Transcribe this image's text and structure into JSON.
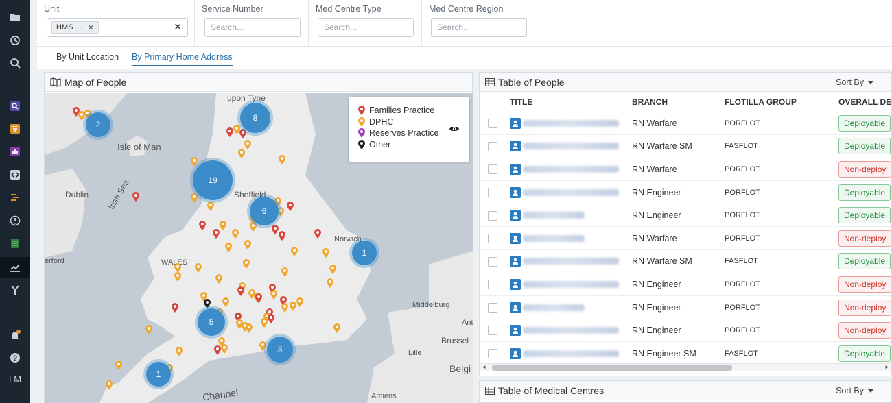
{
  "sidebar": {
    "icons": [
      "folder-icon",
      "history-icon",
      "search-icon",
      "search-square-icon",
      "funnel-icon",
      "bar-chart-icon",
      "code-icon",
      "flow-icon",
      "alert-circle-icon",
      "checklist-icon",
      "line-chart-icon",
      "merge-icon",
      "bell-icon",
      "help-icon"
    ],
    "user_initials": "LM"
  },
  "filters": {
    "unit": {
      "label": "Unit",
      "tag": "HMS    ....",
      "clear": "✕"
    },
    "service_number": {
      "label": "Service Number",
      "placeholder": "Search..."
    },
    "med_centre_type": {
      "label": "Med Centre Type",
      "placeholder": "Search..."
    },
    "med_centre_region": {
      "label": "Med Centre Region",
      "placeholder": "Search..."
    }
  },
  "tabs": [
    {
      "label": "By Unit Location"
    },
    {
      "label": "By Primary Home Address",
      "active": true
    }
  ],
  "map": {
    "title": "Map of People",
    "places": [
      "upon Tyne",
      "Isle of Man",
      "Dublin",
      "Irish Sea",
      "Sheffield",
      "Norwich",
      "erford",
      "WALES",
      "Middelburg",
      "Brussel",
      "Lille",
      "Belgi",
      "Channel",
      "Amiens",
      "Ant"
    ],
    "clusters": [
      "2",
      "8",
      "19",
      "6",
      "1",
      "5",
      "3",
      "1"
    ],
    "legend": [
      {
        "label": "Families Practice",
        "color": "#d8453b"
      },
      {
        "label": "DPHC",
        "color": "#f0a830"
      },
      {
        "label": "Reserves Practice",
        "color": "#a23bb8"
      },
      {
        "label": "Other",
        "color": "#1a1a1a"
      }
    ],
    "pin_colors": {
      "families": "#d8453b",
      "dphc": "#f0a830",
      "other": "#1a1a1a"
    }
  },
  "people_table": {
    "title": "Table of People",
    "sort_label": "Sort By",
    "columns": [
      "TITLE",
      "BRANCH",
      "FLOTILLA GROUP",
      "OVERALL DE"
    ],
    "rows": [
      {
        "branch": "RN Warfare",
        "flotilla": "PORFLOT",
        "status": "Deployable",
        "kind": "dep"
      },
      {
        "branch": "RN Warfare SM",
        "flotilla": "FASFLOT",
        "status": "Deployable",
        "kind": "dep"
      },
      {
        "branch": "RN Warfare",
        "flotilla": "PORFLOT",
        "status": "Non-deploy",
        "kind": "non"
      },
      {
        "branch": "RN Engineer",
        "flotilla": "PORFLOT",
        "status": "Deployable",
        "kind": "dep"
      },
      {
        "branch": "RN Engineer",
        "flotilla": "PORFLOT",
        "status": "Deployable",
        "kind": "dep"
      },
      {
        "branch": "RN Warfare",
        "flotilla": "PORFLOT",
        "status": "Non-deploy",
        "kind": "non"
      },
      {
        "branch": "RN Warfare SM",
        "flotilla": "FASFLOT",
        "status": "Deployable",
        "kind": "dep"
      },
      {
        "branch": "RN Engineer",
        "flotilla": "PORFLOT",
        "status": "Non-deploy",
        "kind": "non"
      },
      {
        "branch": "RN Engineer",
        "flotilla": "PORFLOT",
        "status": "Non-deploy",
        "kind": "non"
      },
      {
        "branch": "RN Engineer",
        "flotilla": "PORFLOT",
        "status": "Non-deploy",
        "kind": "non"
      },
      {
        "branch": "RN Engineer SM",
        "flotilla": "FASFLOT",
        "status": "Deployable",
        "kind": "dep"
      }
    ]
  },
  "med_table": {
    "title": "Table of Medical Centres",
    "sort_label": "Sort By"
  }
}
